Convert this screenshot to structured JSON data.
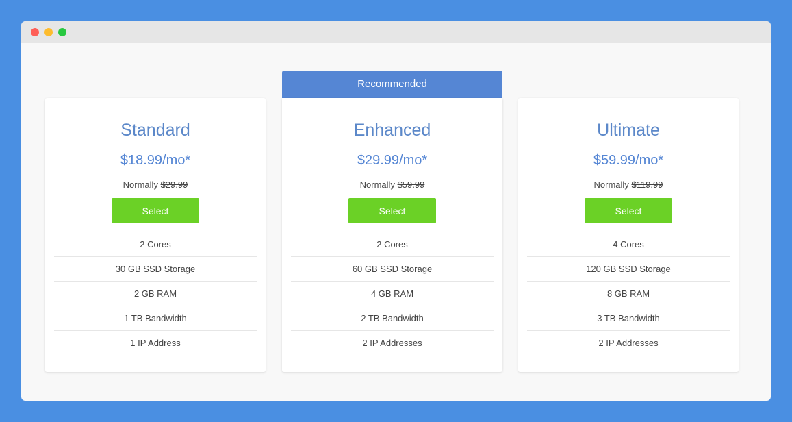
{
  "window": {
    "controls": [
      "close",
      "minimize",
      "maximize"
    ]
  },
  "ribbon": {
    "label": "Recommended"
  },
  "plans": [
    {
      "name": "Standard",
      "price": "$18.99/mo*",
      "normally_label": "Normally ",
      "normally_price": "$29.99",
      "select_label": "Select",
      "features": [
        "2 Cores",
        "30 GB SSD Storage",
        "2 GB RAM",
        "1 TB Bandwidth",
        "1 IP Address"
      ]
    },
    {
      "name": "Enhanced",
      "price": "$29.99/mo*",
      "normally_label": "Normally ",
      "normally_price": "$59.99",
      "select_label": "Select",
      "features": [
        "2 Cores",
        "60 GB SSD Storage",
        "4 GB RAM",
        "2 TB Bandwidth",
        "2 IP Addresses"
      ]
    },
    {
      "name": "Ultimate",
      "price": "$59.99/mo*",
      "normally_label": "Normally ",
      "normally_price": "$119.99",
      "select_label": "Select",
      "features": [
        "4 Cores",
        "120 GB SSD Storage",
        "8 GB RAM",
        "3 TB Bandwidth",
        "2 IP Addresses"
      ]
    }
  ],
  "colors": {
    "background": "#4a8fe2",
    "accent": "#5586d4",
    "button": "#6bd126",
    "title_text": "#5c88c9"
  }
}
